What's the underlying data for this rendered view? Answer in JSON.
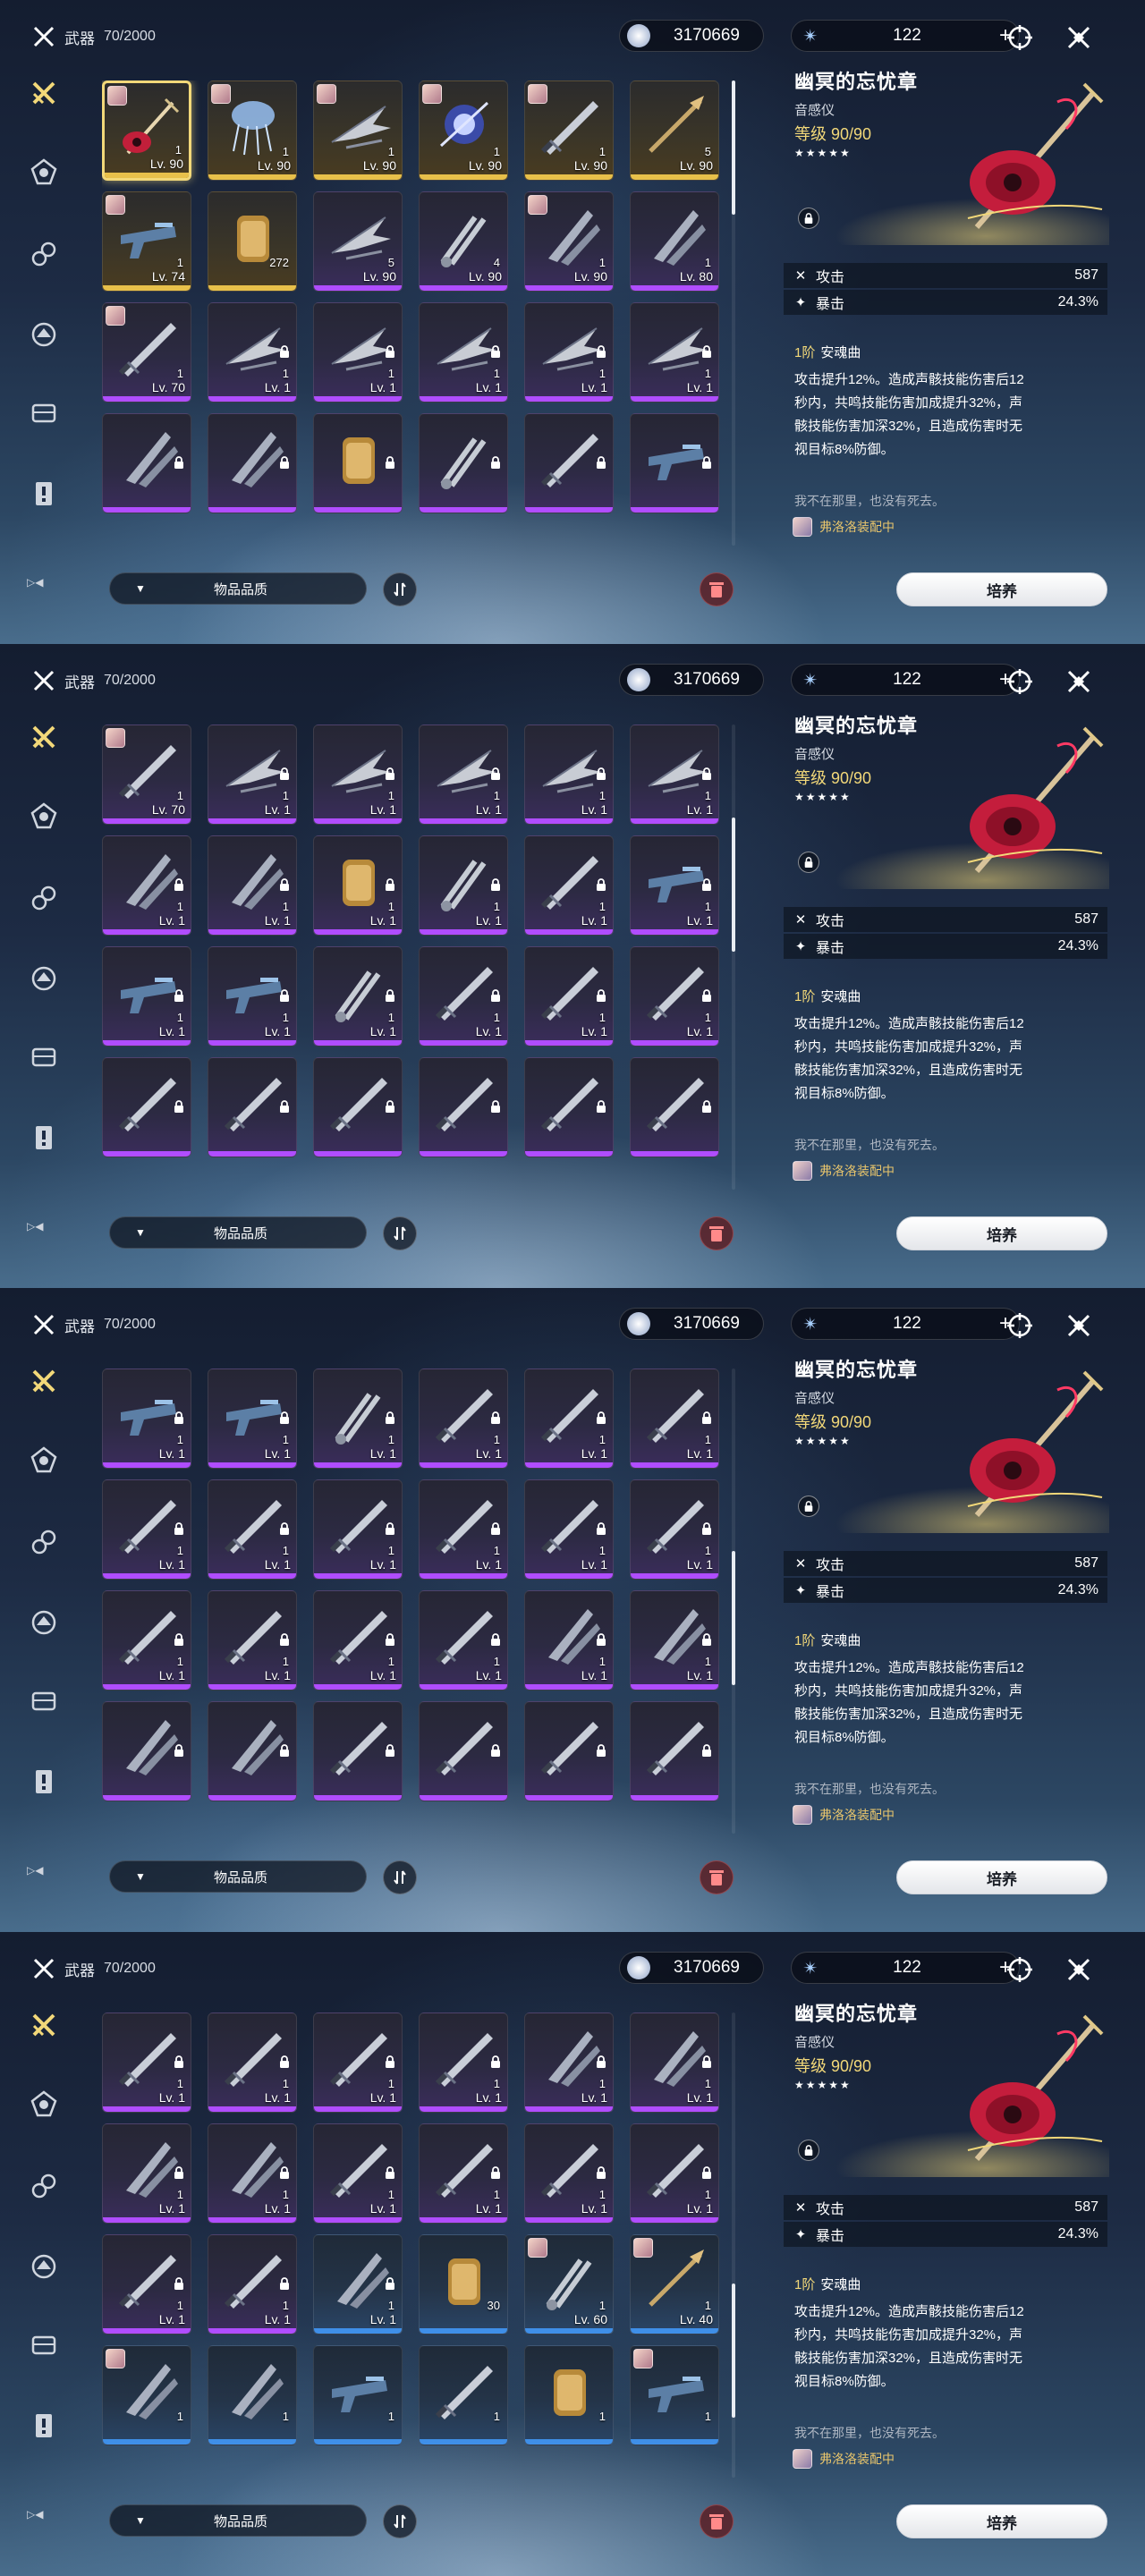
{
  "header": {
    "category": "武器",
    "count": "70/2000"
  },
  "currency": {
    "shell_credits": "3170669",
    "astrite": "122",
    "plus": "+"
  },
  "filter": {
    "label": "物品品质",
    "icon": "▼"
  },
  "colors": {
    "gold": "#f2d879",
    "purple": "#b04dff",
    "blue": "#3f8fe8",
    "green": "#46b07a"
  },
  "detail": {
    "name": "幽冥的忘忧章",
    "type": "音感仪",
    "level_label": "等级",
    "level": "90/90",
    "stars": "★★★★★",
    "stats": [
      {
        "icon": "✕",
        "label": "攻击",
        "value": "587"
      },
      {
        "icon": "✦",
        "label": "暴击",
        "value": "24.3%"
      }
    ],
    "rank": "1阶",
    "skill_name": "安魂曲",
    "desc": [
      "攻击提升12%。造成声骸技能伤害后12",
      "秒内，共鸣技能伤害加成提升32%，声",
      "骸技能伤害加深32%，且造成伤害时无",
      "视目标8%防御。"
    ],
    "quote": "我不在那里，也没有死去。",
    "equipped": "弗洛洛装配中",
    "button": "培养"
  },
  "screens": [
    {
      "scroll": 0.0,
      "items": [
        {
          "r": 5,
          "lv": "Lv. 90",
          "c": "1",
          "av": true,
          "sel": true,
          "k": "guitar"
        },
        {
          "r": 5,
          "lv": "Lv. 90",
          "c": "1",
          "av": true,
          "k": "jelly"
        },
        {
          "r": 5,
          "lv": "Lv. 90",
          "c": "1",
          "av": true,
          "k": "wing"
        },
        {
          "r": 5,
          "lv": "Lv. 90",
          "c": "1",
          "av": true,
          "k": "orb"
        },
        {
          "r": 5,
          "lv": "Lv. 90",
          "c": "1",
          "av": true,
          "k": "sword"
        },
        {
          "r": 5,
          "lv": "Lv. 90",
          "c": "5",
          "k": "stick"
        },
        {
          "r": 5,
          "lv": "Lv. 74",
          "c": "1",
          "av": true,
          "k": "gun"
        },
        {
          "r": 5,
          "lv": "",
          "c": "272",
          "k": "tube"
        },
        {
          "r": 4,
          "lv": "Lv. 90",
          "c": "5",
          "k": "wing"
        },
        {
          "r": 4,
          "lv": "Lv. 90",
          "c": "4",
          "k": "tongs"
        },
        {
          "r": 4,
          "lv": "Lv. 90",
          "c": "1",
          "av": true,
          "k": "blade"
        },
        {
          "r": 4,
          "lv": "Lv. 80",
          "c": "1",
          "k": "blade"
        },
        {
          "r": 4,
          "lv": "Lv. 70",
          "c": "1",
          "av": true,
          "k": "sword"
        },
        {
          "r": 4,
          "lv": "Lv. 1",
          "c": "1",
          "lock": true,
          "k": "wing"
        },
        {
          "r": 4,
          "lv": "Lv. 1",
          "c": "1",
          "lock": true,
          "k": "wing"
        },
        {
          "r": 4,
          "lv": "Lv. 1",
          "c": "1",
          "lock": true,
          "k": "wing"
        },
        {
          "r": 4,
          "lv": "Lv. 1",
          "c": "1",
          "lock": true,
          "k": "wing"
        },
        {
          "r": 4,
          "lv": "Lv. 1",
          "c": "1",
          "lock": true,
          "k": "wing"
        },
        {
          "r": 4,
          "lv": "",
          "c": "",
          "lock": true,
          "k": "blade"
        },
        {
          "r": 4,
          "lv": "",
          "c": "",
          "lock": true,
          "k": "blade"
        },
        {
          "r": 4,
          "lv": "",
          "c": "",
          "lock": true,
          "k": "tube"
        },
        {
          "r": 4,
          "lv": "",
          "c": "",
          "lock": true,
          "k": "tongs"
        },
        {
          "r": 4,
          "lv": "",
          "c": "",
          "lock": true,
          "k": "sword"
        },
        {
          "r": 4,
          "lv": "",
          "c": "",
          "lock": true,
          "k": "gun"
        }
      ]
    },
    {
      "scroll": 0.28,
      "items": [
        {
          "r": 4,
          "lv": "Lv. 70",
          "c": "1",
          "av": true,
          "k": "sword"
        },
        {
          "r": 4,
          "lv": "Lv. 1",
          "c": "1",
          "lock": true,
          "k": "wing"
        },
        {
          "r": 4,
          "lv": "Lv. 1",
          "c": "1",
          "lock": true,
          "k": "wing"
        },
        {
          "r": 4,
          "lv": "Lv. 1",
          "c": "1",
          "lock": true,
          "k": "wing"
        },
        {
          "r": 4,
          "lv": "Lv. 1",
          "c": "1",
          "lock": true,
          "k": "wing"
        },
        {
          "r": 4,
          "lv": "Lv. 1",
          "c": "1",
          "lock": true,
          "k": "wing"
        },
        {
          "r": 4,
          "lv": "Lv. 1",
          "c": "1",
          "lock": true,
          "k": "blade"
        },
        {
          "r": 4,
          "lv": "Lv. 1",
          "c": "1",
          "lock": true,
          "k": "blade"
        },
        {
          "r": 4,
          "lv": "Lv. 1",
          "c": "1",
          "lock": true,
          "k": "tube"
        },
        {
          "r": 4,
          "lv": "Lv. 1",
          "c": "1",
          "lock": true,
          "k": "tongs"
        },
        {
          "r": 4,
          "lv": "Lv. 1",
          "c": "1",
          "lock": true,
          "k": "sword"
        },
        {
          "r": 4,
          "lv": "Lv. 1",
          "c": "1",
          "lock": true,
          "k": "gun"
        },
        {
          "r": 4,
          "lv": "Lv. 1",
          "c": "1",
          "lock": true,
          "k": "gun"
        },
        {
          "r": 4,
          "lv": "Lv. 1",
          "c": "1",
          "lock": true,
          "k": "gun"
        },
        {
          "r": 4,
          "lv": "Lv. 1",
          "c": "1",
          "lock": true,
          "k": "tongs"
        },
        {
          "r": 4,
          "lv": "Lv. 1",
          "c": "1",
          "lock": true,
          "k": "sword"
        },
        {
          "r": 4,
          "lv": "Lv. 1",
          "c": "1",
          "lock": true,
          "k": "sword"
        },
        {
          "r": 4,
          "lv": "Lv. 1",
          "c": "1",
          "lock": true,
          "k": "sword"
        },
        {
          "r": 4,
          "lv": "",
          "c": "",
          "lock": true,
          "k": "sword"
        },
        {
          "r": 4,
          "lv": "",
          "c": "",
          "lock": true,
          "k": "sword"
        },
        {
          "r": 4,
          "lv": "",
          "c": "",
          "lock": true,
          "k": "sword"
        },
        {
          "r": 4,
          "lv": "",
          "c": "",
          "lock": true,
          "k": "sword"
        },
        {
          "r": 4,
          "lv": "",
          "c": "",
          "lock": true,
          "k": "sword"
        },
        {
          "r": 4,
          "lv": "",
          "c": "",
          "lock": true,
          "k": "sword"
        }
      ]
    },
    {
      "scroll": 0.55,
      "items": [
        {
          "r": 4,
          "lv": "Lv. 1",
          "c": "1",
          "lock": true,
          "k": "gun"
        },
        {
          "r": 4,
          "lv": "Lv. 1",
          "c": "1",
          "lock": true,
          "k": "gun"
        },
        {
          "r": 4,
          "lv": "Lv. 1",
          "c": "1",
          "lock": true,
          "k": "tongs"
        },
        {
          "r": 4,
          "lv": "Lv. 1",
          "c": "1",
          "lock": true,
          "k": "sword"
        },
        {
          "r": 4,
          "lv": "Lv. 1",
          "c": "1",
          "lock": true,
          "k": "sword"
        },
        {
          "r": 4,
          "lv": "Lv. 1",
          "c": "1",
          "lock": true,
          "k": "sword"
        },
        {
          "r": 4,
          "lv": "Lv. 1",
          "c": "1",
          "lock": true,
          "k": "sword"
        },
        {
          "r": 4,
          "lv": "Lv. 1",
          "c": "1",
          "lock": true,
          "k": "sword"
        },
        {
          "r": 4,
          "lv": "Lv. 1",
          "c": "1",
          "lock": true,
          "k": "sword"
        },
        {
          "r": 4,
          "lv": "Lv. 1",
          "c": "1",
          "lock": true,
          "k": "sword"
        },
        {
          "r": 4,
          "lv": "Lv. 1",
          "c": "1",
          "lock": true,
          "k": "sword"
        },
        {
          "r": 4,
          "lv": "Lv. 1",
          "c": "1",
          "lock": true,
          "k": "sword"
        },
        {
          "r": 4,
          "lv": "Lv. 1",
          "c": "1",
          "lock": true,
          "k": "sword"
        },
        {
          "r": 4,
          "lv": "Lv. 1",
          "c": "1",
          "lock": true,
          "k": "sword"
        },
        {
          "r": 4,
          "lv": "Lv. 1",
          "c": "1",
          "lock": true,
          "k": "sword"
        },
        {
          "r": 4,
          "lv": "Lv. 1",
          "c": "1",
          "lock": true,
          "k": "sword"
        },
        {
          "r": 4,
          "lv": "Lv. 1",
          "c": "1",
          "lock": true,
          "k": "blade"
        },
        {
          "r": 4,
          "lv": "Lv. 1",
          "c": "1",
          "lock": true,
          "k": "blade"
        },
        {
          "r": 4,
          "lv": "",
          "c": "",
          "lock": true,
          "k": "blade"
        },
        {
          "r": 4,
          "lv": "",
          "c": "",
          "lock": true,
          "k": "blade"
        },
        {
          "r": 4,
          "lv": "",
          "c": "",
          "lock": true,
          "k": "sword"
        },
        {
          "r": 4,
          "lv": "",
          "c": "",
          "lock": true,
          "k": "sword"
        },
        {
          "r": 4,
          "lv": "",
          "c": "",
          "lock": true,
          "k": "sword"
        },
        {
          "r": 4,
          "lv": "",
          "c": "",
          "lock": true,
          "k": "sword"
        }
      ]
    },
    {
      "scroll": 0.82,
      "items": [
        {
          "r": 4,
          "lv": "Lv. 1",
          "c": "1",
          "lock": true,
          "k": "sword"
        },
        {
          "r": 4,
          "lv": "Lv. 1",
          "c": "1",
          "lock": true,
          "k": "sword"
        },
        {
          "r": 4,
          "lv": "Lv. 1",
          "c": "1",
          "lock": true,
          "k": "sword"
        },
        {
          "r": 4,
          "lv": "Lv. 1",
          "c": "1",
          "lock": true,
          "k": "sword"
        },
        {
          "r": 4,
          "lv": "Lv. 1",
          "c": "1",
          "lock": true,
          "k": "blade"
        },
        {
          "r": 4,
          "lv": "Lv. 1",
          "c": "1",
          "lock": true,
          "k": "blade"
        },
        {
          "r": 4,
          "lv": "Lv. 1",
          "c": "1",
          "lock": true,
          "k": "blade"
        },
        {
          "r": 4,
          "lv": "Lv. 1",
          "c": "1",
          "lock": true,
          "k": "blade"
        },
        {
          "r": 4,
          "lv": "Lv. 1",
          "c": "1",
          "lock": true,
          "k": "sword"
        },
        {
          "r": 4,
          "lv": "Lv. 1",
          "c": "1",
          "lock": true,
          "k": "sword"
        },
        {
          "r": 4,
          "lv": "Lv. 1",
          "c": "1",
          "lock": true,
          "k": "sword"
        },
        {
          "r": 4,
          "lv": "Lv. 1",
          "c": "1",
          "lock": true,
          "k": "sword"
        },
        {
          "r": 4,
          "lv": "Lv. 1",
          "c": "1",
          "lock": true,
          "k": "sword"
        },
        {
          "r": 4,
          "lv": "Lv. 1",
          "c": "1",
          "lock": true,
          "k": "sword"
        },
        {
          "r": 3,
          "lv": "Lv. 1",
          "c": "1",
          "lock": true,
          "k": "blade"
        },
        {
          "r": 3,
          "lv": "",
          "c": "30",
          "k": "tube"
        },
        {
          "r": 3,
          "lv": "Lv. 60",
          "c": "1",
          "av": true,
          "k": "tongs"
        },
        {
          "r": 3,
          "lv": "Lv. 40",
          "c": "1",
          "av": true,
          "k": "stick"
        },
        {
          "r": 3,
          "lv": "",
          "c": "1",
          "av": true,
          "k": "blade"
        },
        {
          "r": 3,
          "lv": "",
          "c": "1",
          "k": "blade"
        },
        {
          "r": 3,
          "lv": "",
          "c": "1",
          "k": "gun"
        },
        {
          "r": 3,
          "lv": "",
          "c": "1",
          "k": "sword"
        },
        {
          "r": 3,
          "lv": "",
          "c": "1",
          "k": "tube"
        },
        {
          "r": 3,
          "lv": "",
          "c": "1",
          "av": true,
          "k": "gun"
        }
      ]
    }
  ]
}
